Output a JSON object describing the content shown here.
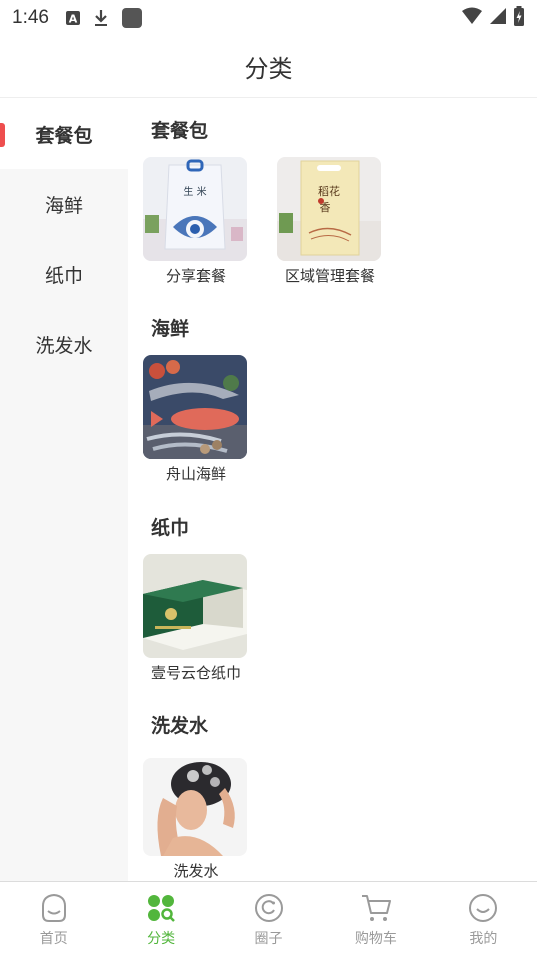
{
  "status_bar": {
    "time": "1:46",
    "icons": [
      "a-badge-icon",
      "download-icon",
      "app-square-icon",
      "wifi-icon",
      "signal-icon",
      "battery-charging-icon"
    ]
  },
  "header": {
    "title": "分类"
  },
  "colors": {
    "accent": "#52b63c",
    "active_indicator": "#ee4e4e",
    "sidebar_bg": "#f7f7f7",
    "inactive_tab": "#9a9a9a"
  },
  "sidebar": {
    "items": [
      {
        "label": "套餐包",
        "active": true
      },
      {
        "label": "海鲜",
        "active": false
      },
      {
        "label": "纸巾",
        "active": false
      },
      {
        "label": "洗发水",
        "active": false
      }
    ]
  },
  "sections": [
    {
      "title": "套餐包",
      "products": [
        {
          "name": "分享套餐"
        },
        {
          "name": "区域管理套餐"
        }
      ]
    },
    {
      "title": "海鲜",
      "products": [
        {
          "name": "舟山海鲜"
        }
      ]
    },
    {
      "title": "纸巾",
      "products": [
        {
          "name": "壹号云仓纸巾"
        }
      ]
    },
    {
      "title": "洗发水",
      "products": [
        {
          "name": "洗发水"
        }
      ]
    }
  ],
  "tab_bar": {
    "tabs": [
      {
        "label": "首页",
        "icon": "home-face-icon",
        "active": false
      },
      {
        "label": "分类",
        "icon": "category-grid-icon",
        "active": true
      },
      {
        "label": "圈子",
        "icon": "circle-icon",
        "active": false
      },
      {
        "label": "购物车",
        "icon": "cart-icon",
        "active": false
      },
      {
        "label": "我的",
        "icon": "profile-smile-icon",
        "active": false
      }
    ]
  }
}
